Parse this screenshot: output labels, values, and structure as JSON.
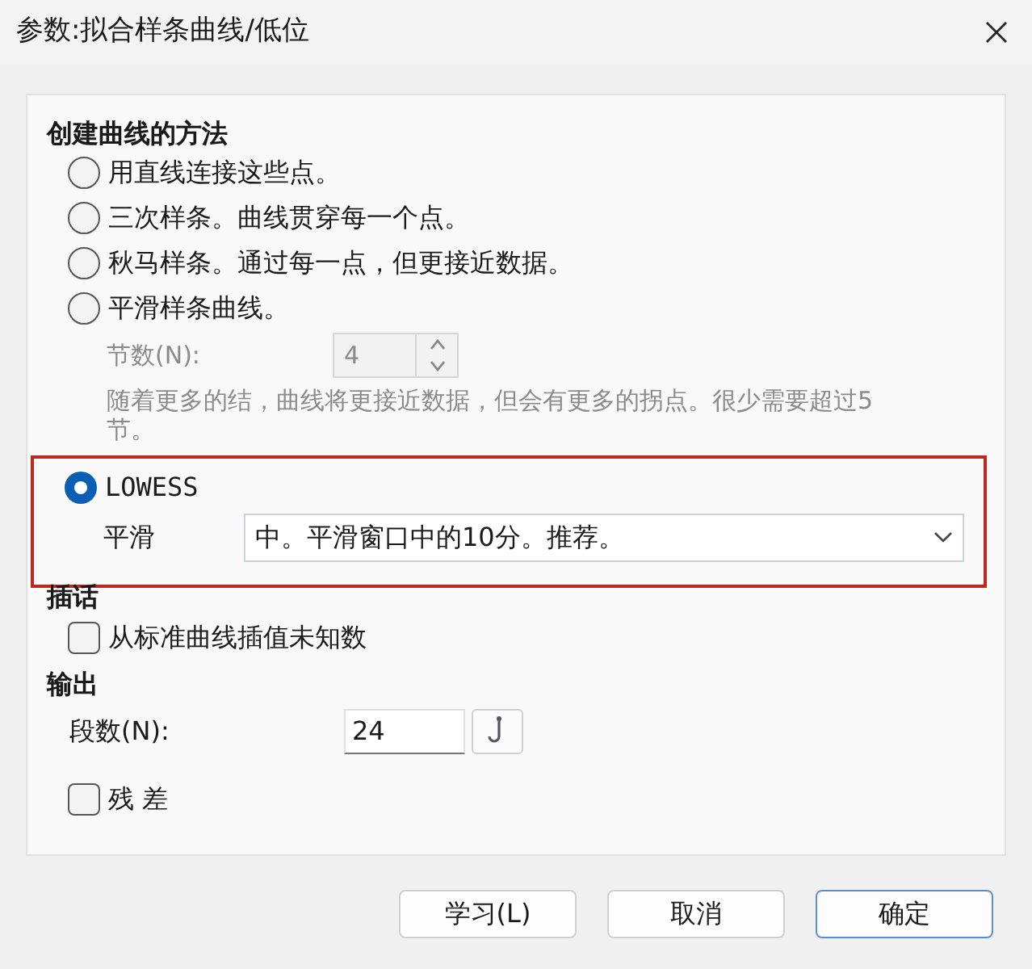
{
  "window": {
    "title": "参数:拟合样条曲线/低位"
  },
  "method_section": {
    "heading": "创建曲线的方法",
    "options": [
      {
        "kind": "plain",
        "label": "用直线连接这些点。",
        "selected": false,
        "highlighted": false
      },
      {
        "kind": "plain",
        "label": "三次样条。曲线贯穿每一个点。",
        "selected": false,
        "highlighted": false
      },
      {
        "kind": "plain",
        "label": "秋马样条。通过每一点，但更接近数据。",
        "selected": false,
        "highlighted": false
      },
      {
        "kind": "spline",
        "label": "平滑样条曲线。",
        "selected": false,
        "highlighted": false,
        "knots": {
          "label": "节数(N):",
          "value": "4",
          "disabled": true
        },
        "note": "随着更多的结，曲线将更接近数据，但会有更多的拐点。很少需要超过5节。"
      },
      {
        "kind": "lowess",
        "label": "LOWESS",
        "selected": true,
        "highlighted": true,
        "smoothing": {
          "label": "平滑",
          "value": "中。平滑窗口中的10分。推荐。"
        }
      }
    ]
  },
  "interpolation_section": {
    "heading": "插话",
    "checkbox": {
      "label": "从标准曲线插值未知数",
      "checked": false
    }
  },
  "output_section": {
    "heading": "输出",
    "segments": {
      "label": "段数(N):",
      "value": "24"
    },
    "residuals": {
      "label": "残 差",
      "checked": false
    }
  },
  "buttons": [
    {
      "label": "学习(L)",
      "default": false
    },
    {
      "label": "取消",
      "default": false
    },
    {
      "label": "确定",
      "default": true
    }
  ]
}
